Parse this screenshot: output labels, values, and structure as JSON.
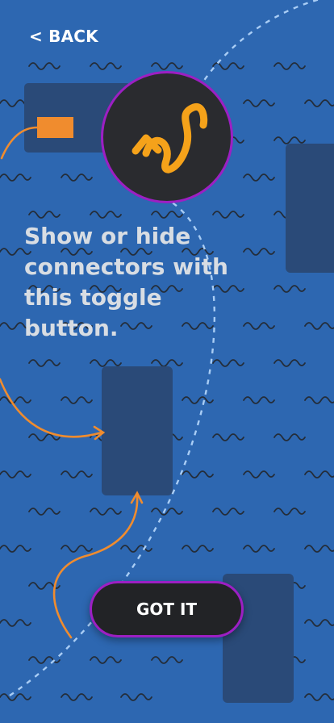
{
  "nav": {
    "back_label": "< BACK"
  },
  "toggle": {
    "icon": "connector-toggle-icon"
  },
  "tutorial": {
    "message": "Show or hide\nconnectors with\nthis toggle\nbutton."
  },
  "actions": {
    "got_it_label": "GOT IT"
  },
  "colors": {
    "background": "#2d67b1",
    "panel": "#2a4a78",
    "accent_orange": "#f08c2e",
    "accent_purple": "#9d1fc3",
    "icon_yellow": "#f5a21a",
    "button_dark": "#222326",
    "dashed_curve": "#a9cdf5"
  }
}
